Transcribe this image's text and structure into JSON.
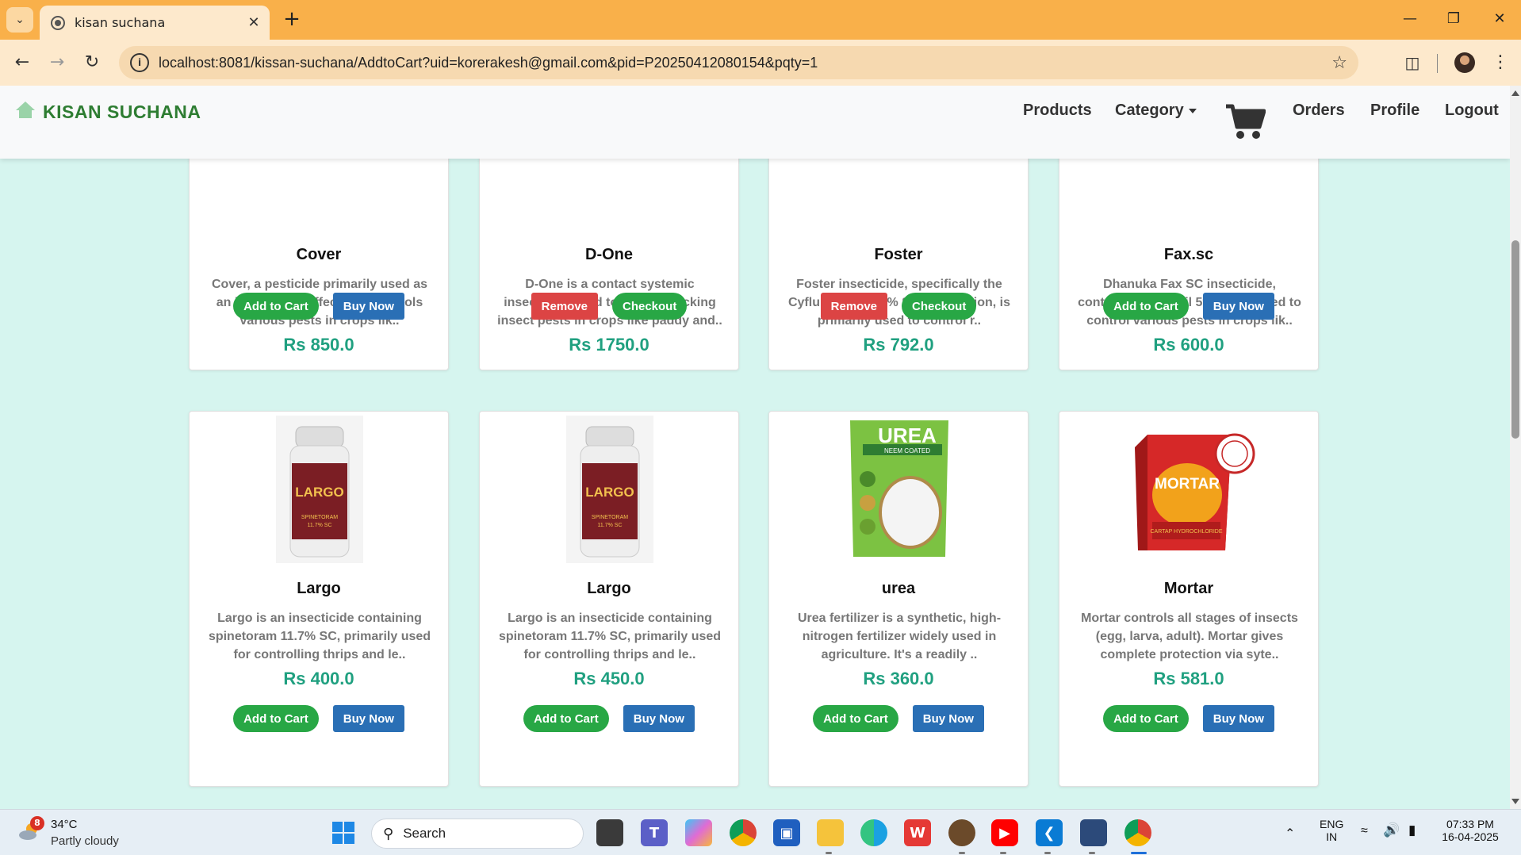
{
  "browser": {
    "tab_title": "kisan suchana",
    "url": "localhost:8081/kissan-suchana/AddtoCart?uid=korerakesh@gmail.com&pid=P20250412080154&pqty=1"
  },
  "navbar": {
    "brand": "KISAN SUCHANA",
    "links": {
      "products": "Products",
      "category": "Category",
      "orders": "Orders",
      "profile": "Profile",
      "logout": "Logout"
    }
  },
  "products": [
    {
      "name": "Cover",
      "desc": [
        "Cover, a pesticide primarily used as",
        "an insecticide, effectively controls",
        "various pests in crops lik.."
      ],
      "price": "Rs 850.0",
      "btn1": "Add to Cart",
      "btn2": "Buy Now",
      "in_cart": false
    },
    {
      "name": "D-One",
      "desc": [
        "D-One is a contact systemic",
        "insecticide used to control sucking",
        "insect pests in crops like paddy and.."
      ],
      "price": "Rs 1750.0",
      "btn1": "Remove",
      "btn2": "Checkout",
      "in_cart": true
    },
    {
      "name": "Foster",
      "desc": [
        "Foster insecticide, specifically the",
        "Cyflumetofen 20% SC formulation, is",
        "primarily used to control r.."
      ],
      "price": "Rs 792.0",
      "btn1": "Remove",
      "btn2": "Checkout",
      "in_cart": true
    },
    {
      "name": "Fax.sc",
      "desc": [
        "Dhanuka Fax SC insecticide,",
        "containing Fipronil 5% SC, is used to",
        "control various pests in crops lik.."
      ],
      "price": "Rs 600.0",
      "btn1": "Add to Cart",
      "btn2": "Buy Now",
      "in_cart": false
    },
    {
      "name": "Largo",
      "desc": [
        "Largo is an insecticide containing",
        "spinetoram 11.7% SC, primarily used",
        "for controlling thrips and le.."
      ],
      "price": "Rs 400.0",
      "btn1": "Add to Cart",
      "btn2": "Buy Now",
      "in_cart": false,
      "image_label": "LARGO",
      "image_sub": "SPINETORAM 11.7% SC"
    },
    {
      "name": "Largo",
      "desc": [
        "Largo is an insecticide containing",
        "spinetoram 11.7% SC, primarily used",
        "for controlling thrips and le.."
      ],
      "price": "Rs 450.0",
      "btn1": "Add to Cart",
      "btn2": "Buy Now",
      "in_cart": false,
      "image_label": "LARGO",
      "image_sub": "SPINETORAM 11.7% SC"
    },
    {
      "name": "urea",
      "desc": [
        "Urea fertilizer is a synthetic, high-",
        "nitrogen fertilizer widely used in",
        "agriculture. It's a readily .."
      ],
      "price": "Rs 360.0",
      "btn1": "Add to Cart",
      "btn2": "Buy Now",
      "in_cart": false,
      "image_label": "UREA",
      "image_sub": "NEEM COATED"
    },
    {
      "name": "Mortar",
      "desc": [
        "Mortar controls all stages of insects",
        "(egg, larva, adult). Mortar gives",
        "complete protection via syte.."
      ],
      "price": "Rs 581.0",
      "btn1": "Add to Cart",
      "btn2": "Buy Now",
      "in_cart": false,
      "image_label": "MORTAR",
      "image_sub": "CARTAP HYDROCHLORIDE 75% SG"
    }
  ],
  "taskbar": {
    "weather_badge": "8",
    "temperature": "34°C",
    "weather": "Partly cloudy",
    "search": "Search",
    "lang1": "ENG",
    "lang2": "IN",
    "time": "07:33 PM",
    "date": "16-04-2025"
  },
  "colors": {
    "accent_green": "#28a745",
    "price_teal": "#20a080",
    "button_blue": "#2a6fb5",
    "remove_red": "#dc4444",
    "page_bg": "#d6f5ef",
    "brand_green": "#2e7d32"
  }
}
